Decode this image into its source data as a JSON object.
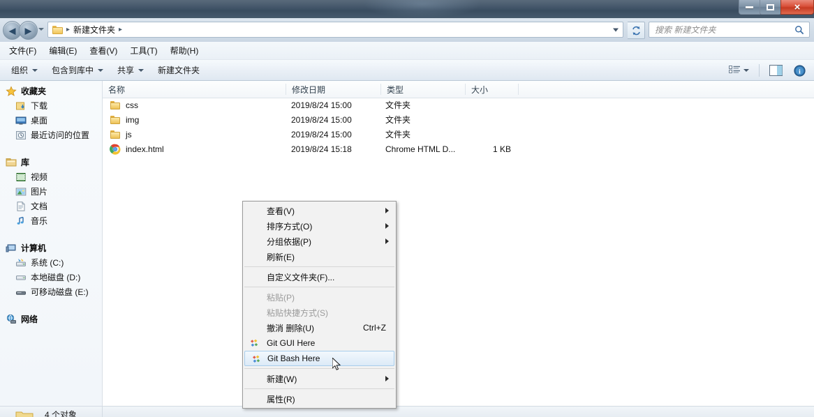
{
  "window": {
    "minimize_label": "最小化",
    "maximize_label": "最大化",
    "close_label": "×"
  },
  "address_bar": {
    "back_label": "◀",
    "forward_label": "▶",
    "folder_icon": "folder-icon",
    "separator": "▸",
    "path_label": "新建文件夹",
    "trailing_separator": "▸",
    "refresh_label": "refresh-icon"
  },
  "search": {
    "placeholder": "搜索 新建文件夹",
    "icon": "search-icon"
  },
  "menubar": {
    "items": [
      {
        "label": "文件(F)"
      },
      {
        "label": "编辑(E)"
      },
      {
        "label": "查看(V)"
      },
      {
        "label": "工具(T)"
      },
      {
        "label": "帮助(H)"
      }
    ]
  },
  "commandbar": {
    "items": [
      {
        "label": "组织",
        "has_caret": true
      },
      {
        "label": "包含到库中",
        "has_caret": true
      },
      {
        "label": "共享",
        "has_caret": true
      },
      {
        "label": "新建文件夹",
        "has_caret": false
      }
    ],
    "right_tools": [
      {
        "name": "view-mode-icon"
      },
      {
        "name": "preview-pane-icon"
      },
      {
        "name": "help-icon"
      }
    ]
  },
  "sidebar": {
    "groups": [
      {
        "head": {
          "label": "收藏夹",
          "icon": "star-icon"
        },
        "children": [
          {
            "label": "下载",
            "icon": "downloads-icon"
          },
          {
            "label": "桌面",
            "icon": "desktop-icon"
          },
          {
            "label": "最近访问的位置",
            "icon": "recent-places-icon"
          }
        ]
      },
      {
        "head": {
          "label": "库",
          "icon": "library-icon"
        },
        "children": [
          {
            "label": "视频",
            "icon": "videos-icon"
          },
          {
            "label": "图片",
            "icon": "pictures-icon"
          },
          {
            "label": "文档",
            "icon": "documents-icon"
          },
          {
            "label": "音乐",
            "icon": "music-icon"
          }
        ]
      },
      {
        "head": {
          "label": "计算机",
          "icon": "computer-icon"
        },
        "children": [
          {
            "label": "系统 (C:)",
            "icon": "system-drive-icon"
          },
          {
            "label": "本地磁盘 (D:)",
            "icon": "local-disk-icon"
          },
          {
            "label": "可移动磁盘 (E:)",
            "icon": "removable-disk-icon"
          }
        ]
      },
      {
        "head": {
          "label": "网络",
          "icon": "network-icon"
        },
        "children": []
      }
    ]
  },
  "file_list": {
    "columns": [
      {
        "label": "名称",
        "key": "name"
      },
      {
        "label": "修改日期",
        "key": "date"
      },
      {
        "label": "类型",
        "key": "type"
      },
      {
        "label": "大小",
        "key": "size"
      }
    ],
    "rows": [
      {
        "name": "css",
        "date": "2019/8/24 15:00",
        "type": "文件夹",
        "size": "",
        "icon": "folder-icon"
      },
      {
        "name": "img",
        "date": "2019/8/24 15:00",
        "type": "文件夹",
        "size": "",
        "icon": "folder-icon"
      },
      {
        "name": "js",
        "date": "2019/8/24 15:00",
        "type": "文件夹",
        "size": "",
        "icon": "folder-icon"
      },
      {
        "name": "index.html",
        "date": "2019/8/24 15:18",
        "type": "Chrome HTML D...",
        "size": "1 KB",
        "icon": "chrome-icon"
      }
    ]
  },
  "context_menu": {
    "items": [
      {
        "label": "查看(V)",
        "submenu": true,
        "disabled": false,
        "accel": "",
        "icon": ""
      },
      {
        "label": "排序方式(O)",
        "submenu": true,
        "disabled": false,
        "accel": "",
        "icon": ""
      },
      {
        "label": "分组依据(P)",
        "submenu": true,
        "disabled": false,
        "accel": "",
        "icon": ""
      },
      {
        "label": "刷新(E)",
        "submenu": false,
        "disabled": false,
        "accel": "",
        "icon": ""
      },
      {
        "separator": true
      },
      {
        "label": "自定义文件夹(F)...",
        "submenu": false,
        "disabled": false,
        "accel": "",
        "icon": ""
      },
      {
        "separator": true
      },
      {
        "label": "粘贴(P)",
        "submenu": false,
        "disabled": true,
        "accel": "",
        "icon": ""
      },
      {
        "label": "粘贴快捷方式(S)",
        "submenu": false,
        "disabled": true,
        "accel": "",
        "icon": ""
      },
      {
        "label": "撤消 删除(U)",
        "submenu": false,
        "disabled": false,
        "accel": "Ctrl+Z",
        "icon": ""
      },
      {
        "label": "Git GUI Here",
        "submenu": false,
        "disabled": false,
        "accel": "",
        "icon": "git-icon"
      },
      {
        "label": "Git Bash Here",
        "submenu": false,
        "disabled": false,
        "accel": "",
        "icon": "git-icon",
        "highlighted": true
      },
      {
        "separator": true
      },
      {
        "label": "新建(W)",
        "submenu": true,
        "disabled": false,
        "accel": "",
        "icon": ""
      },
      {
        "separator": true
      },
      {
        "label": "属性(R)",
        "submenu": false,
        "disabled": false,
        "accel": "",
        "icon": ""
      }
    ]
  },
  "statusbar": {
    "text": "4 个对象",
    "icon": "folder-icon"
  },
  "colors": {
    "titlebar": "#3f5266",
    "close_button": "#d9503a",
    "menu_highlight": "#dceaf7",
    "menu_highlight_border": "#a8cdeb",
    "folder_yellow": "#edc257",
    "accent_blue": "#2b4a68"
  }
}
